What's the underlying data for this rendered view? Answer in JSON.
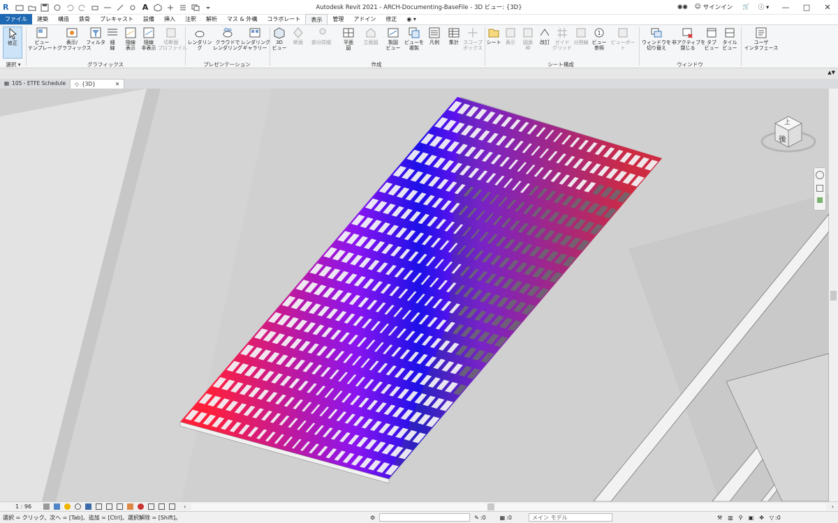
{
  "titlebar": {
    "title": "Autodesk Revit 2021 - ARCH-Documenting-BaseFile - 3D ビュー: {3D}",
    "signin": "サインイン"
  },
  "tabs": [
    "ファイル",
    "建築",
    "構造",
    "鉄骨",
    "プレキャスト",
    "設備",
    "挿入",
    "注釈",
    "解析",
    "マス & 外構",
    "コラボレート",
    "表示",
    "管理",
    "アドイン",
    "修正"
  ],
  "ribbon": {
    "select": {
      "modify": "修正",
      "label": "選択"
    },
    "graphics": {
      "items": [
        "ビュー\nテンプレート",
        "表示/\nグラフィックス",
        "フィルタ",
        "細\n線",
        "隠線\n表示",
        "隠線\n非表示",
        "切断面\nプロファイル"
      ],
      "label": "グラフィックス"
    },
    "presentation": {
      "items": [
        "レンダリング",
        "クラウドで\nレンダリング",
        "レンダリング\nギャラリー"
      ],
      "label": "プレゼンテーション"
    },
    "create": {
      "items": [
        "3D\nビュー",
        "断面",
        "部分詳細",
        "平面\n図",
        "立面図",
        "製図\nビュー",
        "ビューを\n複製",
        "凡例",
        "集計",
        "スコープ\nボックス"
      ],
      "label": "作成"
    },
    "sheet": {
      "items": [
        "シート",
        "表示",
        "図面\n枠",
        "改訂",
        "ガイド\nグリッド",
        "分割線",
        "ビュー\n参照",
        "ビューポート"
      ],
      "label": "シート構成"
    },
    "window": {
      "items": [
        "ウィンドウを\n切り替え",
        "非アクティブを\n閉じる",
        "タブ\nビュー",
        "タイル\nビュー"
      ],
      "label": "ウィンドウ"
    },
    "ui": {
      "label": "ユーザ\nインタフェース"
    }
  },
  "doctabs": [
    {
      "label": "105 - ETFE Schedule",
      "active": false
    },
    {
      "label": "{3D}",
      "active": true
    }
  ],
  "viewcube": {
    "top": "上",
    "front": "後"
  },
  "viewbar": {
    "scale": "1 : 96"
  },
  "status": {
    "message": "選択 = クリック、次へ = [Tab]、追加 = [Ctrl]、選択解除 = [Shift]。",
    "count1": ":0",
    "count2": ":0",
    "model": "メイン モデル"
  },
  "colors": {
    "panel_edge": "#ff1f3a",
    "panel_center": "#1c10e8",
    "file_tab": "#1f69b4"
  }
}
